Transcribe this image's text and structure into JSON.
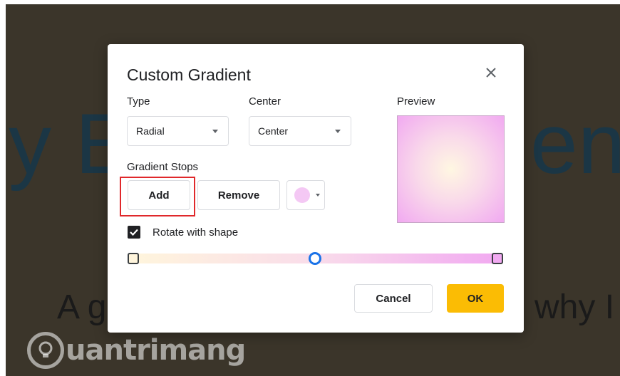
{
  "background": {
    "title_left": "y E",
    "title_right": "ent",
    "subtitle_left": "A g",
    "subtitle_right": "why I"
  },
  "watermark": {
    "logo_icon": "lightbulb-icon",
    "text": "uantrimang"
  },
  "dialog": {
    "title": "Custom Gradient",
    "close_icon": "close-icon",
    "type": {
      "label": "Type",
      "value": "Radial"
    },
    "center": {
      "label": "Center",
      "value": "Center"
    },
    "preview_label": "Preview",
    "gradient_stops_label": "Gradient Stops",
    "add_label": "Add",
    "remove_label": "Remove",
    "stop_color": "#f4c8f4",
    "rotate_label": "Rotate with shape",
    "rotate_checked": true,
    "stops": [
      {
        "color": "#fff5dc",
        "position_pct": 0
      },
      {
        "color": "#f9dcea",
        "position_pct": 50,
        "selected": true
      },
      {
        "color": "#f1a9f1",
        "position_pct": 100
      }
    ],
    "cancel_label": "Cancel",
    "ok_label": "OK",
    "accent_color": "#fbbc04",
    "highlight_color": "#e0282b"
  }
}
